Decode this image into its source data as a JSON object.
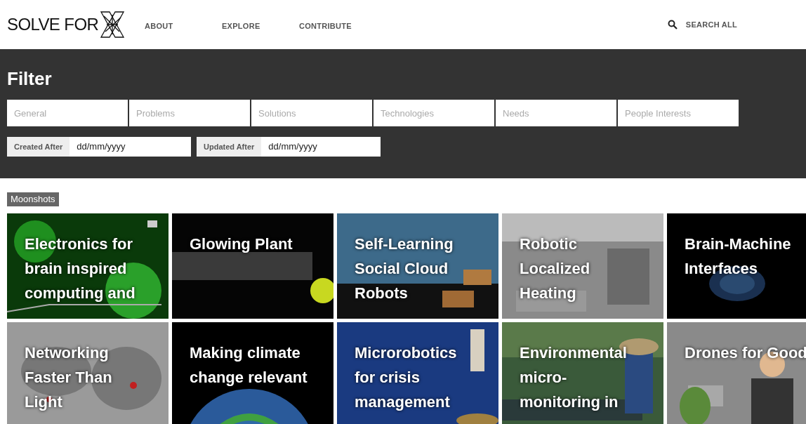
{
  "header": {
    "logo": "SOLVE FOR",
    "nav": [
      "ABOUT",
      "EXPLORE",
      "CONTRIBUTE"
    ],
    "search": "SEARCH ALL"
  },
  "filter": {
    "title": "Filter",
    "fields": [
      {
        "placeholder": "General"
      },
      {
        "placeholder": "Problems"
      },
      {
        "placeholder": "Solutions"
      },
      {
        "placeholder": "Technologies"
      },
      {
        "placeholder": "Needs"
      },
      {
        "placeholder": "People Interests"
      }
    ],
    "dates": [
      {
        "label": "Created After",
        "placeholder": "dd/mm/yyyy"
      },
      {
        "label": "Updated After",
        "placeholder": "dd/mm/yyyy"
      }
    ]
  },
  "section": "Moonshots",
  "tiles": [
    {
      "lines": [
        "Electronics for",
        "brain inspired",
        "computing and"
      ]
    },
    {
      "lines": [
        "Glowing Plant"
      ]
    },
    {
      "lines": [
        "Self-Learning",
        "Social Cloud",
        "Robots"
      ]
    },
    {
      "lines": [
        "Robotic",
        "Localized",
        "Heating"
      ]
    },
    {
      "lines": [
        "Brain-Machine",
        "Interfaces"
      ]
    },
    {
      "lines": [
        "Networking",
        "Faster Than",
        "Light"
      ]
    },
    {
      "lines": [
        "Making climate",
        "change relevant"
      ]
    },
    {
      "lines": [
        "Microrobotics",
        "for crisis",
        "management"
      ]
    },
    {
      "lines": [
        "Environmental",
        "micro-",
        "monitoring in"
      ]
    },
    {
      "lines": [
        "Drones for Good"
      ]
    }
  ]
}
